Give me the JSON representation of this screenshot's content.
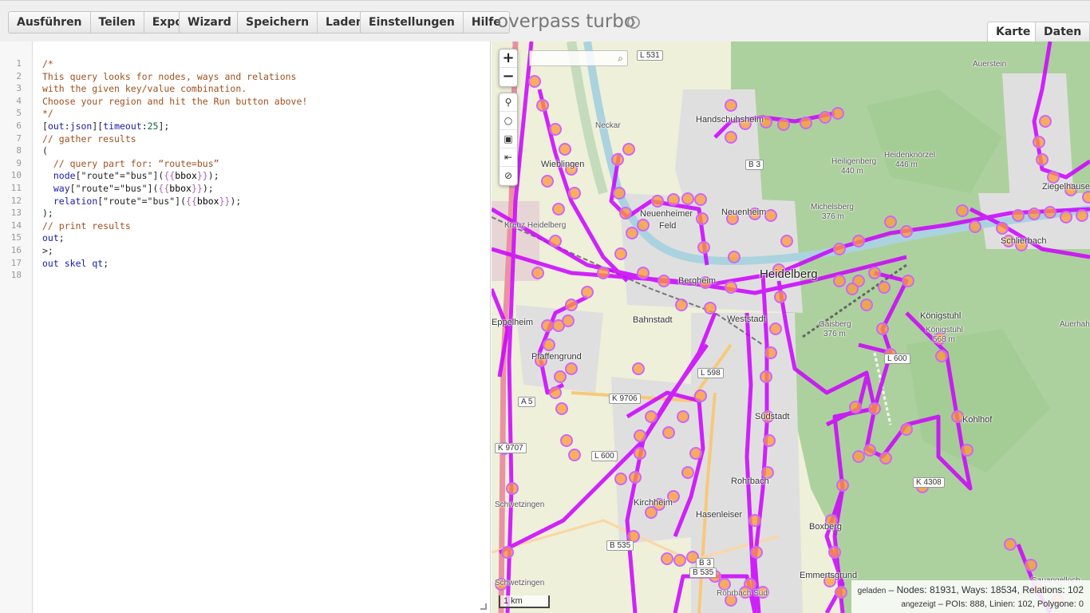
{
  "toolbar": {
    "groups": [
      {
        "buttons": [
          "Ausführen",
          "Teilen",
          "Export"
        ]
      },
      {
        "buttons": [
          "Wizard"
        ]
      },
      {
        "buttons": [
          "Speichern",
          "Laden"
        ]
      },
      {
        "buttons": [
          "Einstellungen",
          "Hilfe"
        ]
      }
    ],
    "title": "overpass turbo",
    "logo_icon": "steering-wheel-icon"
  },
  "tabs": [
    {
      "label": "Karte",
      "active": true
    },
    {
      "label": "Daten",
      "active": false
    }
  ],
  "editor": {
    "line_count": 18,
    "lines": [
      "/*",
      "This query looks for nodes, ways and relations",
      "with the given key/value combination.",
      "Choose your region and hit the Run button above!",
      "*/",
      "[out:json][timeout:25];",
      "// gather results",
      "(",
      "  // query part for: “route=bus”",
      "  node[\"route\"=\"bus\"]({{bbox}});",
      "  way[\"route\"=\"bus\"]({{bbox}});",
      "  relation[\"route\"=\"bus\"]({{bbox}});",
      ");",
      "// print results",
      "out;",
      ">;",
      "out skel qt;",
      ""
    ]
  },
  "map": {
    "zoom_in": "+",
    "zoom_out": "−",
    "tools": [
      "search-icon",
      "circle-icon",
      "image-icon",
      "first-icon",
      "block-icon"
    ],
    "labels": [
      "Auerstein",
      "Handschuhsheim",
      "Heiligenberg",
      "440 m",
      "Heidenknörzel",
      "446 m",
      "Michelsberg",
      "376 m",
      "Ziegelhausen",
      "Schlierbach",
      "Wieblingen",
      "Neuenheimer",
      "Feld",
      "Neuenheim",
      "Heidelberg",
      "Bergheim",
      "Bahnstadt",
      "Weststadt",
      "Gaisberg",
      "376 m",
      "Königstuhl",
      "Königstuhl",
      "568 m",
      "Pfaffengrund",
      "Eppelheim",
      "Südstadt",
      "Kohlhof",
      "Rohrbach",
      "Kirchheim",
      "Hasenleiser",
      "Boxberg",
      "Emmertsgrund",
      "Gauangelloch",
      "Rohrbach Süd",
      "Auerhahn",
      "Kreuz Heidelberg",
      "Schwetzingen",
      "Schwetzingen",
      "Neckar"
    ],
    "road_shields": [
      "L 531",
      "B 3",
      "K 9706",
      "A 5",
      "K 9707",
      "L 600",
      "L 598",
      "L 600",
      "K 4308",
      "B 535",
      "B 535",
      "B 3"
    ],
    "scale": "1 km",
    "stats": {
      "loaded_label": "geladen",
      "loaded_text": "– Nodes: 81931, Ways: 18534, Relations: 102",
      "shown_label": "angezeigt",
      "shown_text": "– POIs: 888, Linien: 102, Polygone: 0"
    },
    "colors": {
      "route": "#cc00ff",
      "poi_fill": "#ff9933",
      "forest": "#aed19f",
      "urban": "#e0dfdf",
      "river": "#aad3df"
    }
  }
}
